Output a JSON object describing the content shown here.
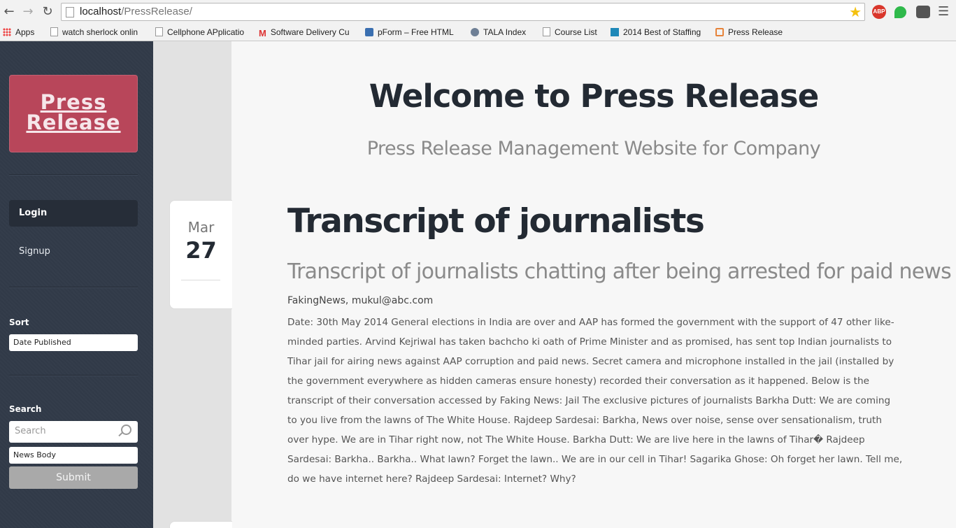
{
  "browser": {
    "url_host": "localhost",
    "url_path": "/PressRelease/",
    "back_icon": "arrow-left-icon",
    "forward_icon": "arrow-right-icon",
    "reload_icon": "reload-icon",
    "star_icon": "star-icon",
    "extensions": [
      {
        "name": "adblock-plus-icon",
        "label": "ABP"
      },
      {
        "name": "evernote-icon",
        "label": ""
      },
      {
        "name": "ghostery-icon",
        "label": ""
      }
    ],
    "menu_icon": "hamburger-menu-icon"
  },
  "bookmarks": [
    {
      "label": "Apps",
      "icon": "apps-grid-icon"
    },
    {
      "label": "watch sherlock onlin",
      "icon": "document-icon"
    },
    {
      "label": "Cellphone APplicatio",
      "icon": "document-icon"
    },
    {
      "label": "Software Delivery Cu",
      "icon": "gmail-icon"
    },
    {
      "label": "pForm – Free HTML",
      "icon": "pform-icon"
    },
    {
      "label": "TALA Index",
      "icon": "globe-icon"
    },
    {
      "label": "Course List",
      "icon": "document-icon"
    },
    {
      "label": "2014 Best of Staffing",
      "icon": "info-icon"
    },
    {
      "label": "Press Release",
      "icon": "xampp-icon"
    }
  ],
  "sidebar": {
    "logo_line1": "Press",
    "logo_line2": "Release",
    "nav": [
      {
        "label": "Login",
        "active": true
      },
      {
        "label": "Signup",
        "active": false
      }
    ],
    "sort_label": "Sort",
    "sort_value": "Date Published",
    "search_label": "Search",
    "search_placeholder": "Search",
    "search_field_value": "News Body",
    "submit_label": "Submit"
  },
  "header": {
    "title": "Welcome to Press Release",
    "subtitle": "Press Release Management Website for Company"
  },
  "post": {
    "month": "Mar",
    "day": "27",
    "title": "Transcript of journalists",
    "subtitle": "Transcript of journalists chatting after being arrested for paid news",
    "meta": "FakingNews, mukul@abc.com",
    "body": "Date: 30th May 2014 General elections in India are over and AAP has formed the government with the support of 47 other like-minded parties. Arvind Kejriwal has taken bachcho ki oath of Prime Minister and as promised, has sent top Indian journalists to Tihar jail for airing news against AAP corruption and paid news. Secret camera and microphone installed in the jail (installed by the government everywhere as hidden cameras ensure honesty) recorded their conversation as it happened. Below is the transcript of their conversation accessed by Faking News: Jail The exclusive pictures of journalists Barkha Dutt: We are coming to you live from the lawns of The White House. Rajdeep Sardesai: Barkha, News over noise, sense over sensationalism, truth over hype. We are in Tihar right now, not The White House. Barkha Dutt: We are live here in the lawns of Tihar� Rajdeep Sardesai: Barkha.. Barkha.. What lawn? Forget the lawn.. We are in our cell in Tihar! Sagarika Ghose: Oh forget her lawn. Tell me, do we have internet here? Rajdeep Sardesai: Internet? Why?"
  }
}
